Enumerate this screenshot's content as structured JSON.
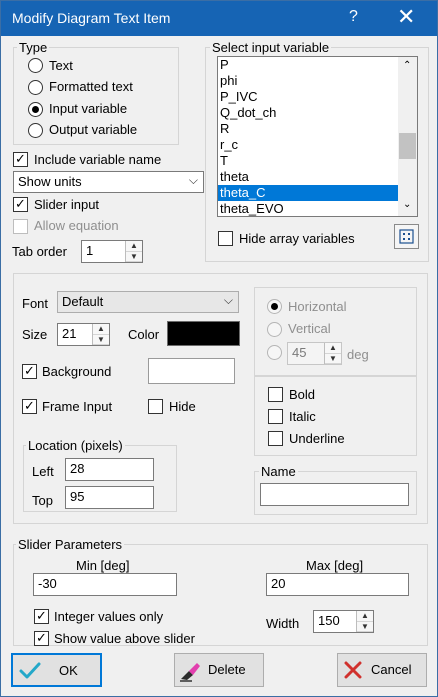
{
  "window": {
    "title": "Modify Diagram Text Item",
    "help": "?",
    "close": "✕"
  },
  "type_group": {
    "label": "Type",
    "options": [
      {
        "label": "Text",
        "selected": false
      },
      {
        "label": "Formatted text",
        "selected": false
      },
      {
        "label": "Input variable",
        "selected": true
      },
      {
        "label": "Output variable",
        "selected": false
      }
    ]
  },
  "include_variable_name": {
    "label": "Include variable name",
    "checked": true
  },
  "units_select": {
    "value": "Show units"
  },
  "slider_input": {
    "label": "Slider input",
    "checked": true
  },
  "allow_equation": {
    "label": "Allow equation",
    "checked": false
  },
  "tab_order": {
    "label": "Tab order",
    "value": "1"
  },
  "input_variable": {
    "label": "Select input variable",
    "items": [
      "P",
      "phi",
      "P_IVC",
      "Q_dot_ch",
      "R",
      "r_c",
      "T",
      "theta",
      "theta_C",
      "theta_EVO"
    ],
    "selected": "theta_C"
  },
  "hide_array": {
    "label": "Hide array variables",
    "checked": false
  },
  "font": {
    "label": "Font",
    "value": "Default"
  },
  "size": {
    "label": "Size",
    "value": "21"
  },
  "color": {
    "label": "Color",
    "value": "#000000"
  },
  "background": {
    "label": "Background",
    "checked": true,
    "color": "#ffffff"
  },
  "frame_input": {
    "label": "Frame Input",
    "checked": true
  },
  "hide": {
    "label": "Hide",
    "checked": false
  },
  "orientation": {
    "horizontal": "Horizontal",
    "vertical": "Vertical",
    "angle": "45",
    "angle_unit": "deg",
    "selected": "horizontal"
  },
  "style": {
    "bold": {
      "label": "Bold",
      "checked": false
    },
    "italic": {
      "label": "Italic",
      "checked": false
    },
    "underline": {
      "label": "Underline",
      "checked": false
    }
  },
  "location": {
    "label": "Location (pixels)",
    "left_label": "Left",
    "left": "28",
    "top_label": "Top",
    "top": "95"
  },
  "name": {
    "label": "Name",
    "value": ""
  },
  "slider": {
    "label": "Slider Parameters",
    "min_label": "Min [deg]",
    "min": "-30",
    "max_label": "Max [deg]",
    "max": "20",
    "integer_only": {
      "label": "Integer values only",
      "checked": true
    },
    "show_value": {
      "label": "Show value above slider",
      "checked": true
    },
    "width_label": "Width",
    "width": "150"
  },
  "buttons": {
    "ok": "OK",
    "delete": "Delete",
    "cancel": "Cancel"
  }
}
